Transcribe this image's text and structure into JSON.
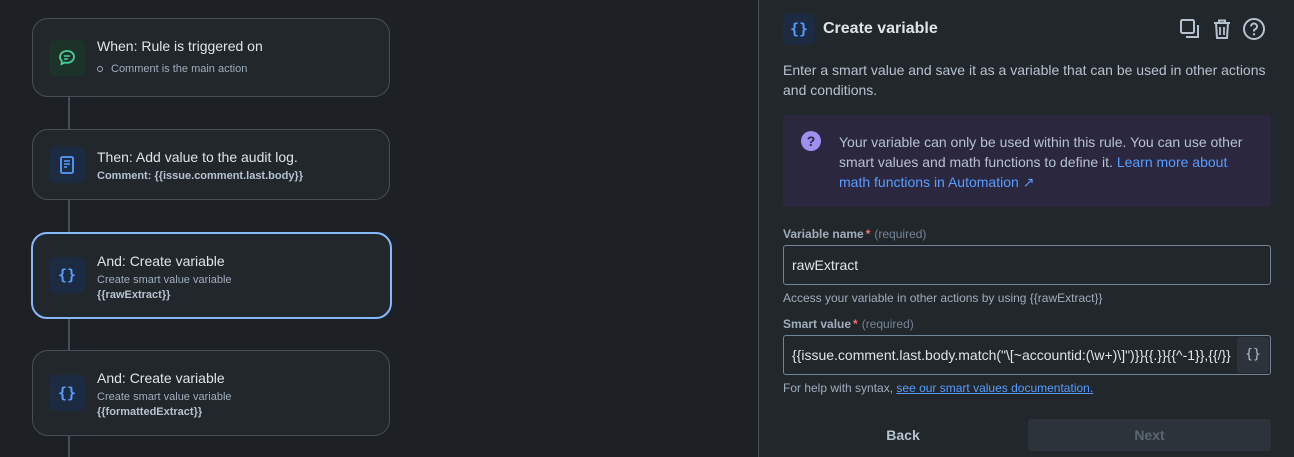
{
  "rule_canvas": {
    "cards": [
      {
        "title": "When: Rule is triggered on",
        "sub": "Comment is the main action",
        "icon": "comment-icon"
      },
      {
        "title": "Then: Add value to the audit log.",
        "bold": "Comment: {{issue.comment.last.body}}",
        "icon": "document-icon"
      },
      {
        "title": "And: Create variable",
        "sub": "Create smart value variable",
        "bold": "{{rawExtract}}",
        "icon": "braces-icon"
      },
      {
        "title": "And: Create variable",
        "sub": "Create smart value variable",
        "bold": "{{formattedExtract}}",
        "icon": "braces-icon"
      }
    ]
  },
  "panel": {
    "title": "Create variable",
    "description": "Enter a smart value and save it as a variable that can be used in other actions and conditions.",
    "info": {
      "text": "Your variable can only be used within this rule. You can use other smart values and math functions to define it. ",
      "link": "Learn more about math functions in Automation ↗"
    },
    "variable_name": {
      "label": "Variable name",
      "required_mark": "*",
      "required_text": "(required)",
      "value": "rawExtract",
      "helper": "Access your variable in other actions by using {{rawExtract}}"
    },
    "smart_value": {
      "label": "Smart value",
      "required_mark": "*",
      "required_text": "(required)",
      "value": "{{issue.comment.last.body.match(\"\\[~accountid:(\\w+)\\]\")}}{{.}}{{^-1}},{{/}}",
      "button": "{}",
      "helper": "For help with syntax, ",
      "helper_link": "see our smart values documentation."
    },
    "buttons": {
      "back": "Back",
      "next": "Next"
    }
  },
  "colors": {
    "accent": "#579dff",
    "selected_border": "#85b8ff",
    "discovery": "#9f8fef"
  }
}
